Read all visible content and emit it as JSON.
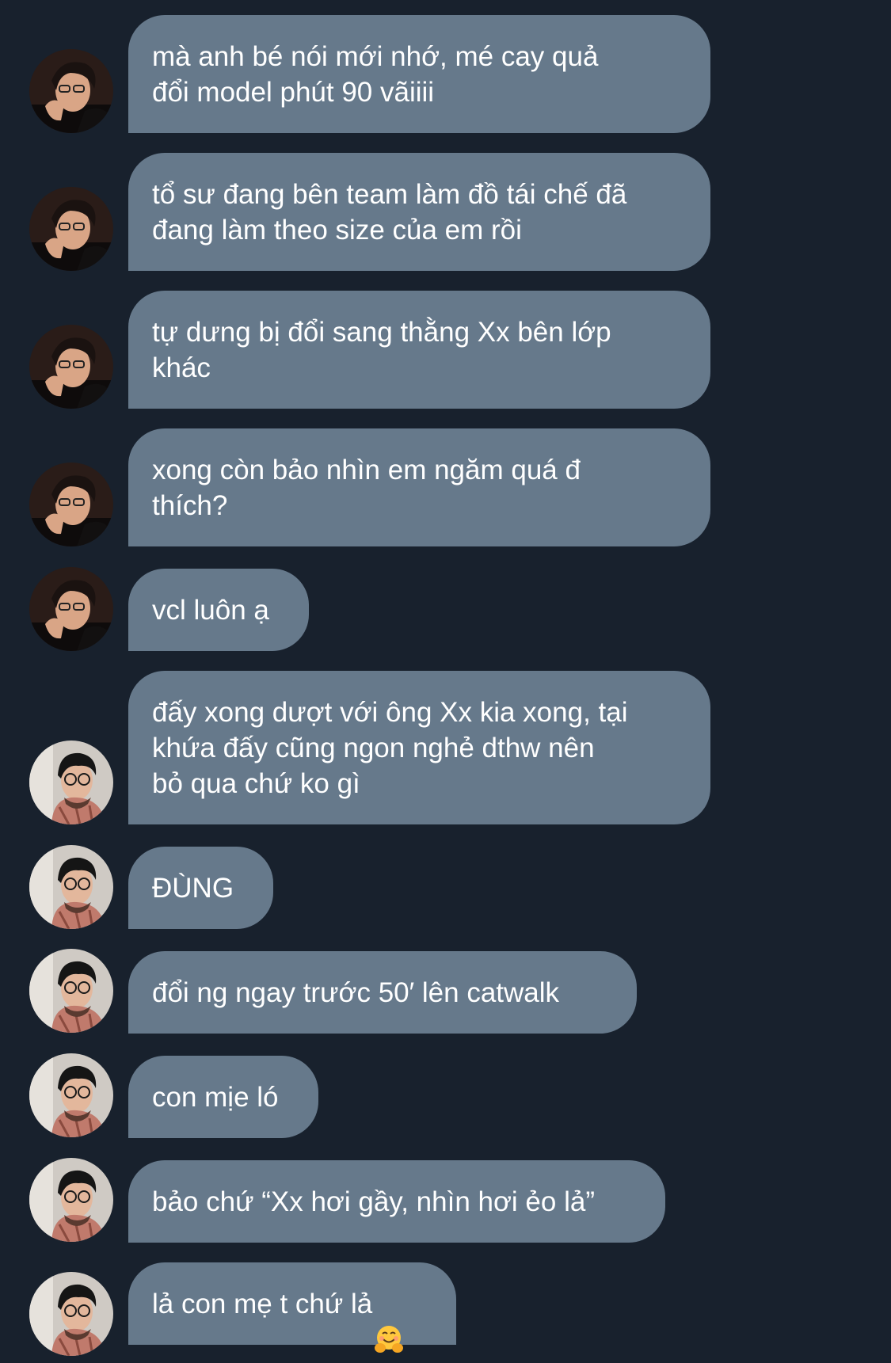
{
  "colors": {
    "background": "#18212d",
    "bubble": "#66798b",
    "text": "#ffffff"
  },
  "messages": [
    {
      "sender": "user-a",
      "text": "mà anh bé nói mới nhớ, mé cay quả\nđổi model phút 90 vãiiii"
    },
    {
      "sender": "user-a",
      "text": "tổ sư đang bên team làm đồ tái chế đã\nđang làm theo size của em rồi"
    },
    {
      "sender": "user-a",
      "text": "tự dưng bị đổi sang thằng Xx bên lớp\nkhác"
    },
    {
      "sender": "user-a",
      "text": "xong còn bảo nhìn em ngăm quá đ\nthích?"
    },
    {
      "sender": "user-a",
      "text": "vcl luôn ạ"
    },
    {
      "sender": "user-b",
      "text": "đấy xong dượt với ông Xx kia xong, tại\nkhứa đấy cũng ngon nghẻ dthw nên\nbỏ qua chứ ko gì"
    },
    {
      "sender": "user-b",
      "text": "ĐÙNG"
    },
    {
      "sender": "user-b",
      "text": "đổi ng ngay trước 50′ lên catwalk"
    },
    {
      "sender": "user-b",
      "text": "con mịe ló"
    },
    {
      "sender": "user-b",
      "text": "bảo chứ “Xx hơi gầy, nhìn hơi ẻo lả”"
    },
    {
      "sender": "user-b",
      "text": "lả con mẹ t chứ lả",
      "emoji": "hugging-face-emoji"
    }
  ]
}
